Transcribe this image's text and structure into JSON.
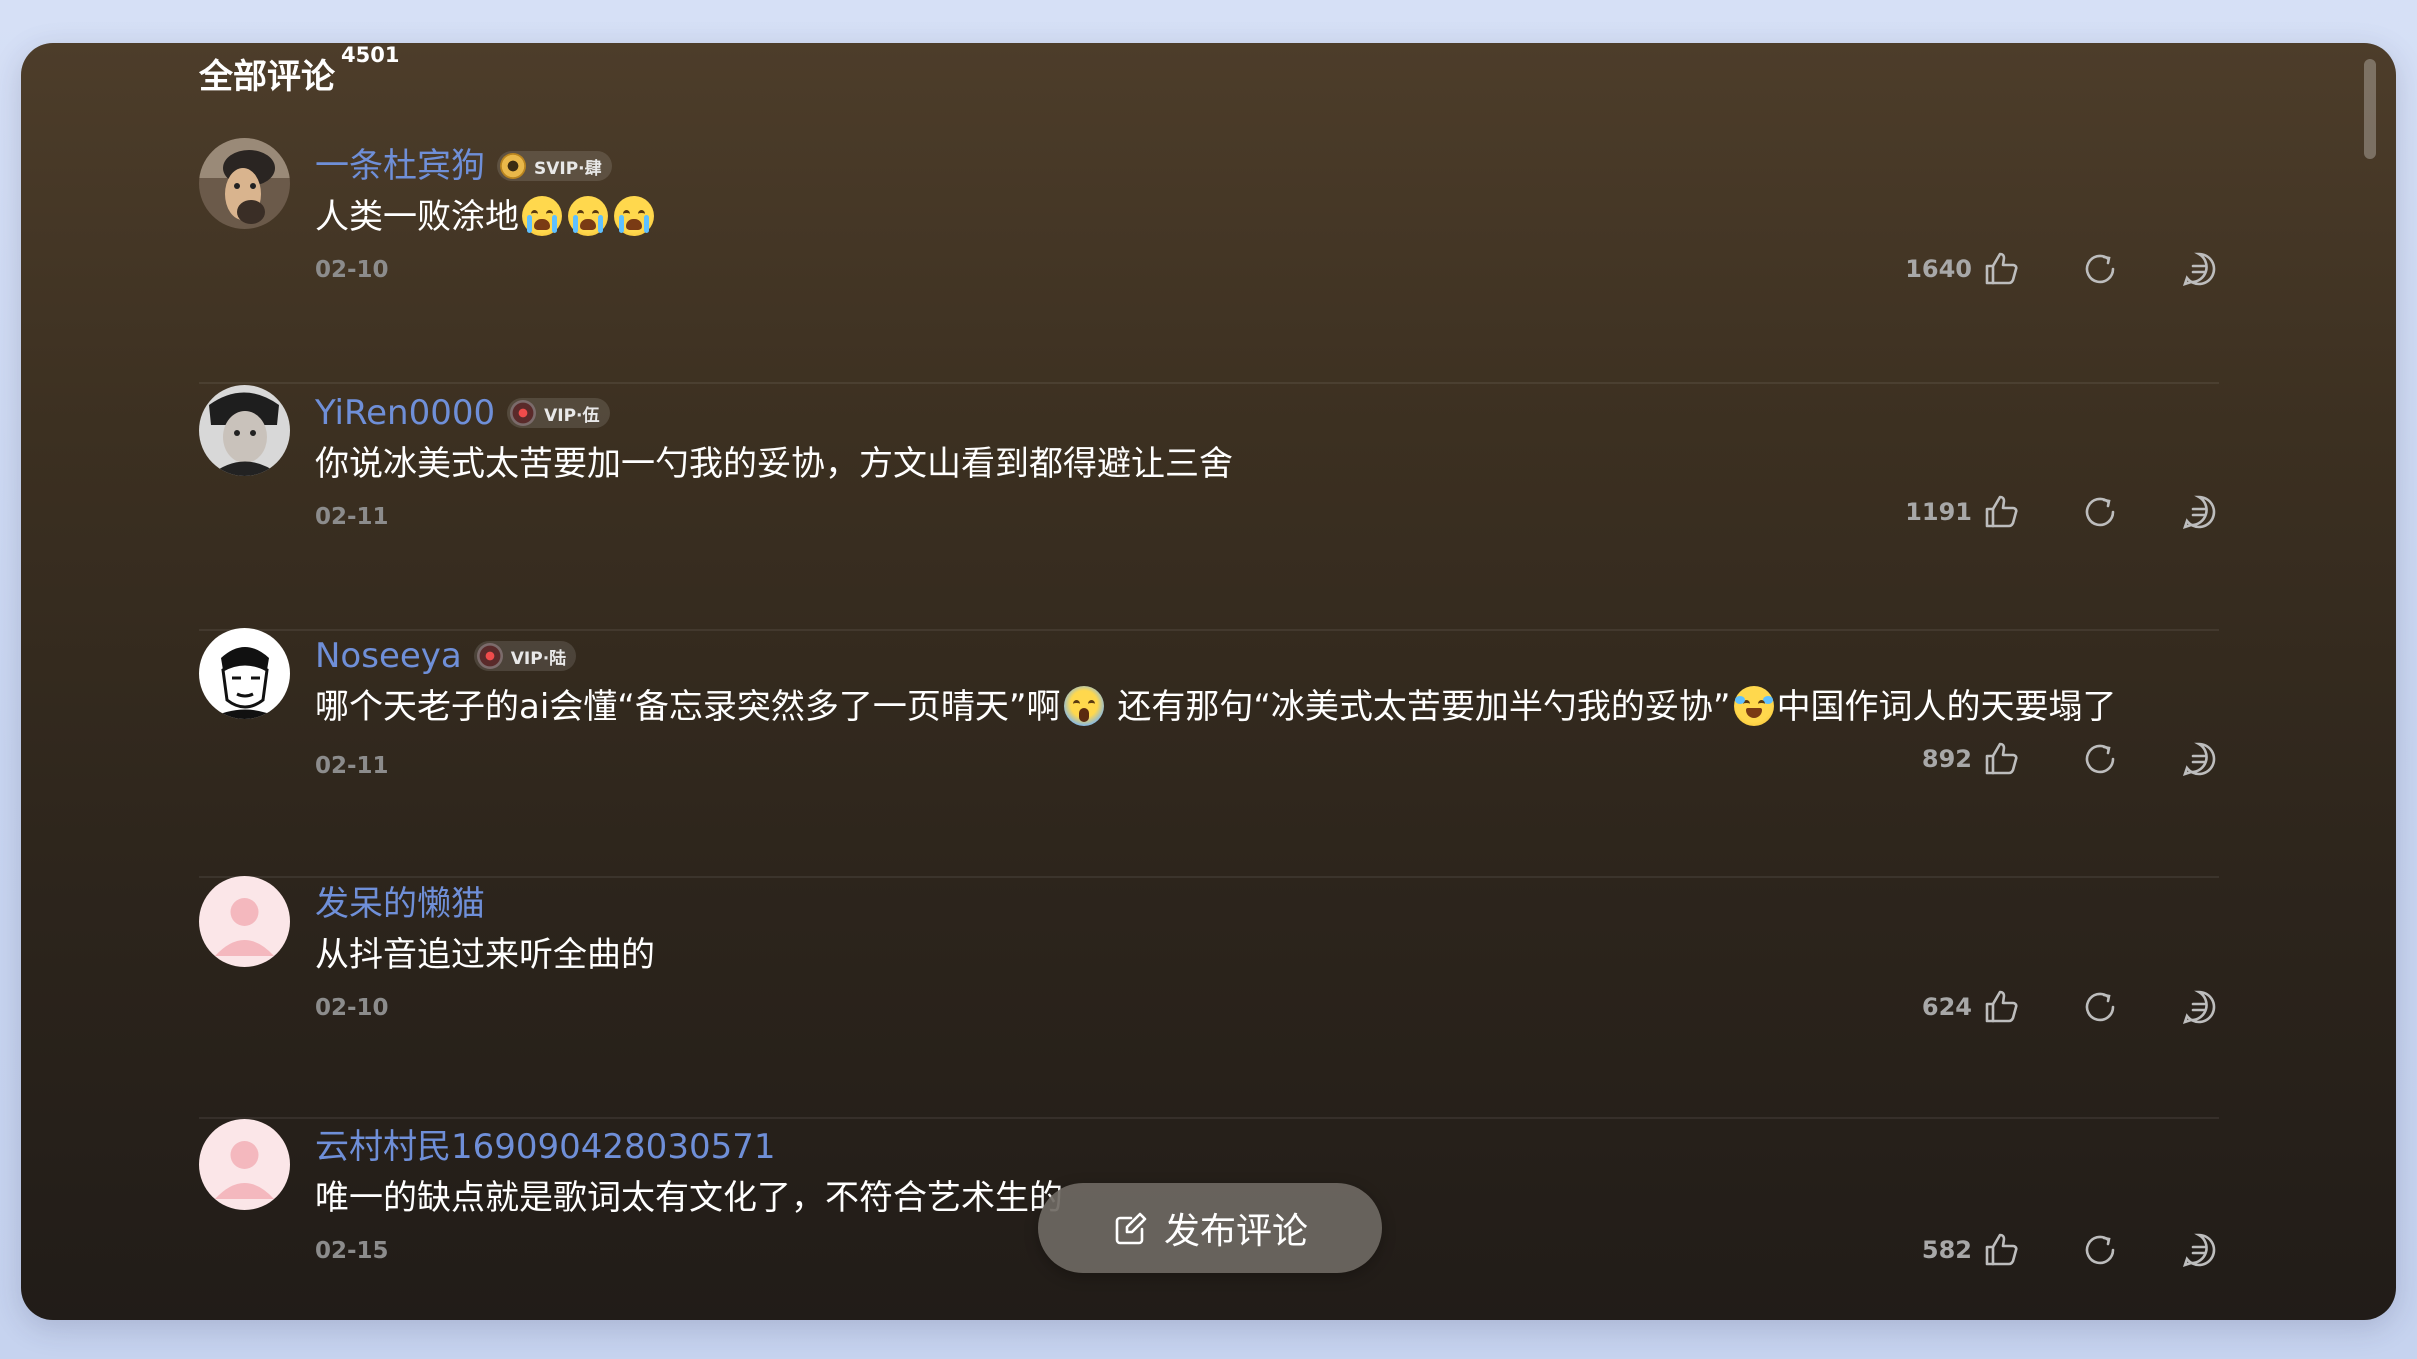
{
  "header": {
    "title": "全部评论",
    "count": "4501"
  },
  "comments": [
    {
      "username": "一条杜宾狗",
      "badge": "SVIP·肆",
      "badge_type": "gold",
      "text": "人类一败涂地",
      "emojis": [
        "loudly-crying-face",
        "loudly-crying-face",
        "loudly-crying-face"
      ],
      "date": "02-10",
      "likes": "1640",
      "avatar": "photo-dog"
    },
    {
      "username": "YiRen0000",
      "badge": "VIP·伍",
      "badge_type": "red",
      "text": "你说冰美式太苦要加一勺我的妥协，方文山看到都得避让三舍",
      "date": "02-11",
      "likes": "1191",
      "avatar": "photo-person"
    },
    {
      "username": "Noseeya",
      "badge": "VIP·陆",
      "badge_type": "red",
      "text_part1": "哪个天老子的ai会懂“备忘录突然多了一页晴天”啊",
      "text_part2": " 还有那句“冰美式太苦要加半勺我的妥协”",
      "text_part3": "中国作词人的天要塌了",
      "emoji1": "face-screaming-in-fear",
      "emoji2": "face-with-tears-of-joy",
      "date": "02-11",
      "likes": "892",
      "avatar": "drawing-face"
    },
    {
      "username": "发呆的懒猫",
      "text": "从抖音追过来听全曲的",
      "date": "02-10",
      "likes": "624",
      "avatar": "default-avatar"
    },
    {
      "username": "云村村民169090428030571",
      "text": "唯一的缺点就是歌词太有文化了，不符合艺术生的",
      "date": "02-15",
      "likes": "582",
      "avatar": "default-avatar"
    }
  ],
  "fab": {
    "label": "发布评论",
    "icon": "edit-icon"
  },
  "colors": {
    "username": "#6f8fd8",
    "panel_top": "#4d3d2a",
    "panel_bottom": "#211c18",
    "page_bg": "#d6e0f6"
  }
}
